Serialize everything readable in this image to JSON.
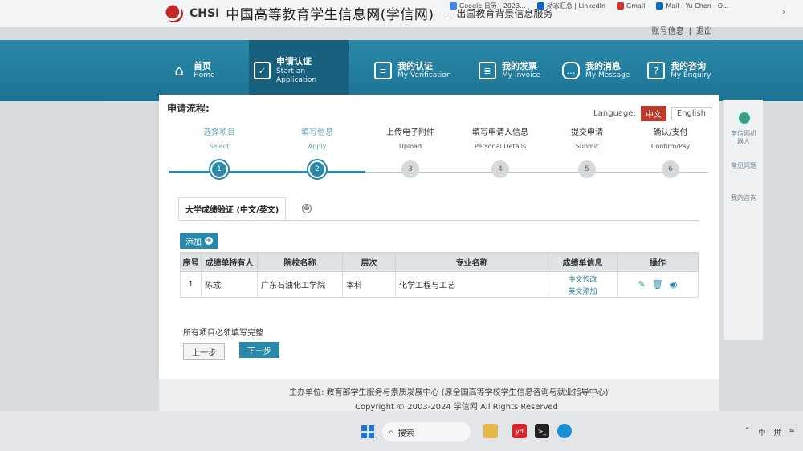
{
  "site": {
    "logo_text": "CHSI",
    "name": "中国高等教育学生信息网(学信网)",
    "subtitle": "— 出国教育背景信息服务"
  },
  "browser_bookmarks": [
    "Google 日历 - 2023...",
    "动态汇总 | LinkedIn",
    "Gmail",
    "Mail - Yu Chen - O..."
  ],
  "account": {
    "info": "账号信息",
    "separator": "|",
    "logout": "退出"
  },
  "nav": [
    {
      "cn": "首页",
      "en": "Home",
      "icon": "home-icon"
    },
    {
      "cn": "申请认证",
      "en": "Start an Application",
      "icon": "checkbox-icon",
      "active": true
    },
    {
      "cn": "我的认证",
      "en": "My Verification",
      "icon": "document-icon"
    },
    {
      "cn": "我的发票",
      "en": "My Invoice",
      "icon": "invoice-icon"
    },
    {
      "cn": "我的消息",
      "en": "My Message",
      "icon": "message-icon"
    },
    {
      "cn": "我的咨询",
      "en": "My Enquiry",
      "icon": "question-icon"
    }
  ],
  "process": {
    "title": "申请流程:",
    "language_label": "Language:",
    "lang_zh": "中文",
    "lang_en": "English",
    "steps": [
      {
        "cn": "选择项目",
        "en": "Select",
        "num": "1",
        "done": true
      },
      {
        "cn": "填写信息",
        "en": "Apply",
        "num": "2",
        "done": true
      },
      {
        "cn": "上传电子附件",
        "en": "Upload",
        "num": "3",
        "done": false
      },
      {
        "cn": "填写申请人信息",
        "en": "Personal Details",
        "num": "4",
        "done": false
      },
      {
        "cn": "提交申请",
        "en": "Submit",
        "num": "5",
        "done": false
      },
      {
        "cn": "确认/支付",
        "en": "Confirm/Pay",
        "num": "6",
        "done": false
      }
    ]
  },
  "tab": {
    "label": "大学成绩验证 (中文/英文)",
    "add_symbol": "⊕"
  },
  "add_button": "添加",
  "table": {
    "headers": [
      "序号",
      "成绩单持有人",
      "院校名称",
      "层次",
      "专业名称",
      "成绩单信息",
      "操作"
    ],
    "rows": [
      {
        "no": "1",
        "holder": "陈彧",
        "school": "广东石油化工学院",
        "level": "本科",
        "major": "化学工程与工艺",
        "link_cn": "中文修改",
        "link_en": "英文添加"
      }
    ]
  },
  "notice": "所有项目必须填写完整",
  "prev_button": "上一步",
  "next_button": "下一步",
  "footer": {
    "sponsor": "主办单位: 教育部学生服务与素质发展中心 (原全国高等学校学生信息咨询与就业指导中心)",
    "copyright": "Copyright © 2003-2024 学信网 All Rights Reserved"
  },
  "side": {
    "robot": "学信网机器人",
    "faq": "常见问题",
    "enquiry": "我的咨询"
  },
  "taskbar": {
    "search": "搜索",
    "tray": [
      "中",
      "拼"
    ]
  },
  "colors": {
    "nav_bg": "#2a88a8",
    "active_nav": "#18607d",
    "lang_active": "#c0392b"
  }
}
